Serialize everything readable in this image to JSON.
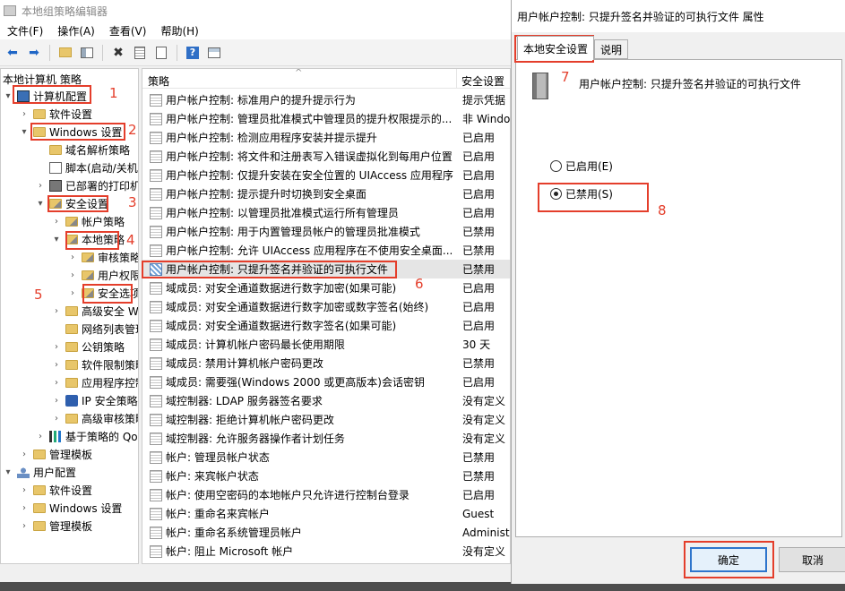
{
  "main_window": {
    "title": "本地组策略编辑器",
    "menu": [
      "文件(F)",
      "操作(A)",
      "查看(V)",
      "帮助(H)"
    ]
  },
  "tree": {
    "root": "本地计算机 策略",
    "items": [
      {
        "label": "计算机配置",
        "indent": 0,
        "twisty": "▾",
        "icon": "computer-icon"
      },
      {
        "label": "软件设置",
        "indent": 1,
        "twisty": "›",
        "icon": "folder-icon"
      },
      {
        "label": "Windows 设置",
        "indent": 1,
        "twisty": "▾",
        "icon": "folder-icon"
      },
      {
        "label": "域名解析策略",
        "indent": 2,
        "twisty": "",
        "icon": "folder-icon"
      },
      {
        "label": "脚本(启动/关机)",
        "indent": 2,
        "twisty": "",
        "icon": "script-icon"
      },
      {
        "label": "已部署的打印机",
        "indent": 2,
        "twisty": "›",
        "icon": "printer-icon"
      },
      {
        "label": "安全设置",
        "indent": 2,
        "twisty": "▾",
        "icon": "security-folder-icon"
      },
      {
        "label": "帐户策略",
        "indent": 3,
        "twisty": "›",
        "icon": "security-folder-icon"
      },
      {
        "label": "本地策略",
        "indent": 3,
        "twisty": "▾",
        "icon": "security-folder-icon"
      },
      {
        "label": "审核策略",
        "indent": 4,
        "twisty": "›",
        "icon": "security-folder-icon"
      },
      {
        "label": "用户权限分",
        "indent": 4,
        "twisty": "›",
        "icon": "security-folder-icon"
      },
      {
        "label": "安全选项",
        "indent": 4,
        "twisty": "›",
        "icon": "security-folder-icon"
      },
      {
        "label": "高级安全 Wind",
        "indent": 3,
        "twisty": "›",
        "icon": "folder-icon"
      },
      {
        "label": "网络列表管理器",
        "indent": 3,
        "twisty": "",
        "icon": "folder-icon"
      },
      {
        "label": "公钥策略",
        "indent": 3,
        "twisty": "›",
        "icon": "folder-icon"
      },
      {
        "label": "软件限制策略",
        "indent": 3,
        "twisty": "›",
        "icon": "folder-icon"
      },
      {
        "label": "应用程序控制",
        "indent": 3,
        "twisty": "›",
        "icon": "folder-icon"
      },
      {
        "label": "IP 安全策略，",
        "indent": 3,
        "twisty": "›",
        "icon": "ip-security-icon"
      },
      {
        "label": "高级审核策略",
        "indent": 3,
        "twisty": "›",
        "icon": "folder-icon"
      },
      {
        "label": "基于策略的 QoS",
        "indent": 2,
        "twisty": "›",
        "icon": "chart-icon"
      },
      {
        "label": "管理模板",
        "indent": 1,
        "twisty": "›",
        "icon": "folder-icon"
      },
      {
        "label": "用户配置",
        "indent": 0,
        "twisty": "▾",
        "icon": "user-icon"
      },
      {
        "label": "软件设置",
        "indent": 1,
        "twisty": "›",
        "icon": "folder-icon"
      },
      {
        "label": "Windows 设置",
        "indent": 1,
        "twisty": "›",
        "icon": "folder-icon"
      },
      {
        "label": "管理模板",
        "indent": 1,
        "twisty": "›",
        "icon": "folder-icon"
      }
    ]
  },
  "list": {
    "col_policy": "策略",
    "col_setting": "安全设置",
    "rows": [
      {
        "name": "用户帐户控制: 标准用户的提升提示行为",
        "value": "提示凭据"
      },
      {
        "name": "用户帐户控制: 管理员批准模式中管理员的提升权限提示的...",
        "value": "非 Windo"
      },
      {
        "name": "用户帐户控制: 检测应用程序安装并提示提升",
        "value": "已启用"
      },
      {
        "name": "用户帐户控制: 将文件和注册表写入错误虚拟化到每用户位置",
        "value": "已启用"
      },
      {
        "name": "用户帐户控制: 仅提升安装在安全位置的 UIAccess 应用程序",
        "value": "已启用"
      },
      {
        "name": "用户帐户控制: 提示提升时切换到安全桌面",
        "value": "已启用"
      },
      {
        "name": "用户帐户控制: 以管理员批准模式运行所有管理员",
        "value": "已启用"
      },
      {
        "name": "用户帐户控制: 用于内置管理员帐户的管理员批准模式",
        "value": "已禁用"
      },
      {
        "name": "用户帐户控制: 允许 UIAccess 应用程序在不使用安全桌面...",
        "value": "已禁用"
      },
      {
        "name": "用户帐户控制: 只提升签名并验证的可执行文件",
        "value": "已禁用"
      },
      {
        "name": "域成员: 对安全通道数据进行数字加密(如果可能)",
        "value": "已启用"
      },
      {
        "name": "域成员: 对安全通道数据进行数字加密或数字签名(始终)",
        "value": "已启用"
      },
      {
        "name": "域成员: 对安全通道数据进行数字签名(如果可能)",
        "value": "已启用"
      },
      {
        "name": "域成员: 计算机帐户密码最长使用期限",
        "value": "30 天"
      },
      {
        "name": "域成员: 禁用计算机帐户密码更改",
        "value": "已禁用"
      },
      {
        "name": "域成员: 需要强(Windows 2000 或更高版本)会话密钥",
        "value": "已启用"
      },
      {
        "name": "域控制器: LDAP 服务器签名要求",
        "value": "没有定义"
      },
      {
        "name": "域控制器: 拒绝计算机帐户密码更改",
        "value": "没有定义"
      },
      {
        "name": "域控制器: 允许服务器操作者计划任务",
        "value": "没有定义"
      },
      {
        "name": "帐户: 管理员帐户状态",
        "value": "已禁用"
      },
      {
        "name": "帐户: 来宾帐户状态",
        "value": "已禁用"
      },
      {
        "name": "帐户: 使用空密码的本地帐户只允许进行控制台登录",
        "value": "已启用"
      },
      {
        "name": "帐户: 重命名来宾帐户",
        "value": "Guest"
      },
      {
        "name": "帐户: 重命名系统管理员帐户",
        "value": "Administ"
      },
      {
        "name": "帐户: 阻止 Microsoft 帐户",
        "value": "没有定义"
      }
    ]
  },
  "dialog": {
    "title": "用户帐户控制: 只提升签名并验证的可执行文件 属性",
    "tab_local": "本地安全设置",
    "tab_explain": "说明",
    "policy_name": "用户帐户控制: 只提升签名并验证的可执行文件",
    "radio_enabled": "已启用(E)",
    "radio_disabled": "已禁用(S)",
    "selected": "disabled",
    "ok": "确定",
    "cancel": "取消"
  },
  "annotations": [
    "1",
    "2",
    "3",
    "4",
    "5",
    "6",
    "7",
    "8"
  ],
  "colors": {
    "annotation": "#e43e2b",
    "default_button_border": "#2e75cc"
  }
}
